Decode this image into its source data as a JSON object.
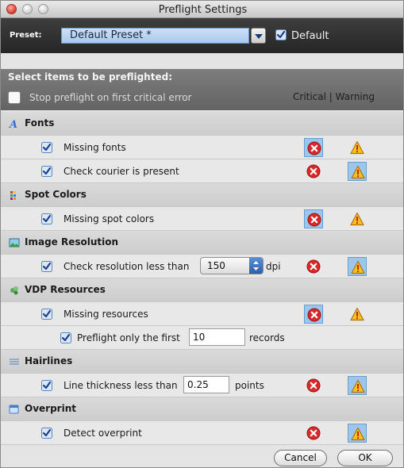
{
  "window": {
    "title": "Preflight Settings"
  },
  "preset": {
    "label": "Preset:",
    "selected_value": "Default Preset *",
    "default_label": "Default",
    "default_checked": true
  },
  "header": {
    "select_items_label": "Select items to be preflighted:",
    "stop_label": "Stop preflight on first critical error",
    "stop_checked": false,
    "columns_label": "Critical | Warning"
  },
  "sections": {
    "fonts": {
      "label": "Fonts",
      "icon": "fonts-icon",
      "items": [
        {
          "label": "Missing fonts",
          "checked": true,
          "selected": "critical"
        },
        {
          "label": "Check courier is present",
          "checked": true,
          "selected": "warning"
        }
      ]
    },
    "spot_colors": {
      "label": "Spot Colors",
      "icon": "spot-colors-icon",
      "items": [
        {
          "label": "Missing spot colors",
          "checked": true,
          "selected": "critical"
        }
      ]
    },
    "image_resolution": {
      "label": "Image Resolution",
      "icon": "image-icon",
      "items": [
        {
          "label": "Check resolution less than",
          "value": "150",
          "unit": "dpi",
          "checked": true,
          "selected": "warning"
        }
      ]
    },
    "vdp_resources": {
      "label": "VDP Resources",
      "icon": "vdp-resources-icon",
      "items": [
        {
          "label": "Missing resources",
          "checked": true,
          "selected": "critical"
        }
      ],
      "sub_item": {
        "label": "Preflight only the first",
        "value": "10",
        "unit": "records",
        "checked": true
      }
    },
    "hairlines": {
      "label": "Hairlines",
      "icon": "hairlines-icon",
      "items": [
        {
          "label": "Line thickness less than",
          "value": "0.25",
          "unit": "points",
          "checked": true,
          "selected": "warning"
        }
      ]
    },
    "overprint": {
      "label": "Overprint",
      "icon": "overprint-icon",
      "items": [
        {
          "label": "Detect overprint",
          "checked": true,
          "selected": "warning"
        }
      ]
    }
  },
  "footer": {
    "cancel_label": "Cancel",
    "ok_label": "OK"
  },
  "colors": {
    "selection": "#9cc6ec",
    "critical": "#d8282a",
    "warning": "#f3c31c",
    "preset_bar": "#2e2e2e",
    "header": "#707070"
  }
}
